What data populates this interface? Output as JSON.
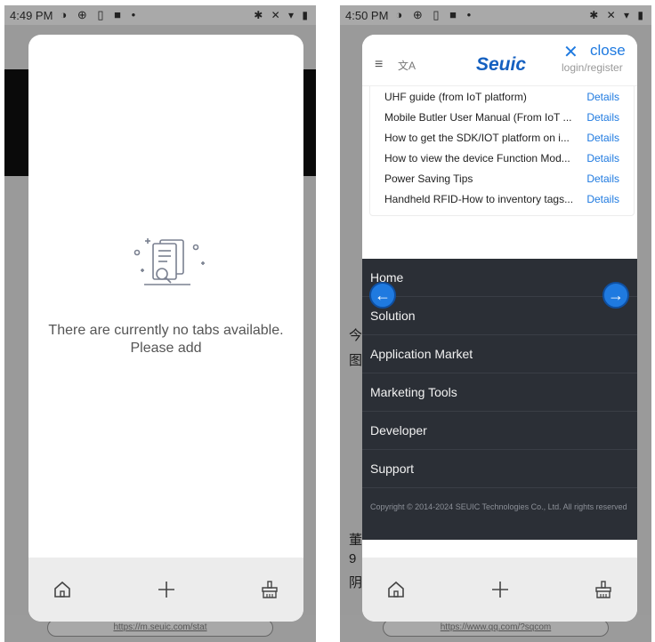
{
  "left": {
    "status_time": "4:49 PM",
    "url": "https://m.seuic.com/stat",
    "empty_text": "There are currently no tabs available. Please add"
  },
  "right": {
    "status_time": "4:50 PM",
    "close_label": "close",
    "login_label": "login/register",
    "brand": "Seuic",
    "url": "https://www.qq.com/?sqcom",
    "guides": [
      {
        "title": "UHF guide (from IoT platform)",
        "link": "Details"
      },
      {
        "title": "Mobile Butler User Manual (From IoT ...",
        "link": "Details"
      },
      {
        "title": "How to get the SDK/IOT platform on i...",
        "link": "Details"
      },
      {
        "title": "How to view the device Function Mod...",
        "link": "Details"
      },
      {
        "title": "Power Saving Tips",
        "link": "Details"
      },
      {
        "title": "Handheld RFID-How to inventory tags...",
        "link": "Details"
      }
    ],
    "menu": [
      "Home",
      "Solution",
      "Application Market",
      "Marketing Tools",
      "Developer",
      "Support"
    ],
    "copyright": "Copyright © 2014-2024 SEUIC Technologies Co., Ltd. All rights reserved"
  },
  "icons": [
    "home-icon",
    "plus-icon",
    "clear-icon",
    "arrow-left-icon",
    "arrow-right-icon",
    "close-icon",
    "menu-icon",
    "translate-icon"
  ]
}
